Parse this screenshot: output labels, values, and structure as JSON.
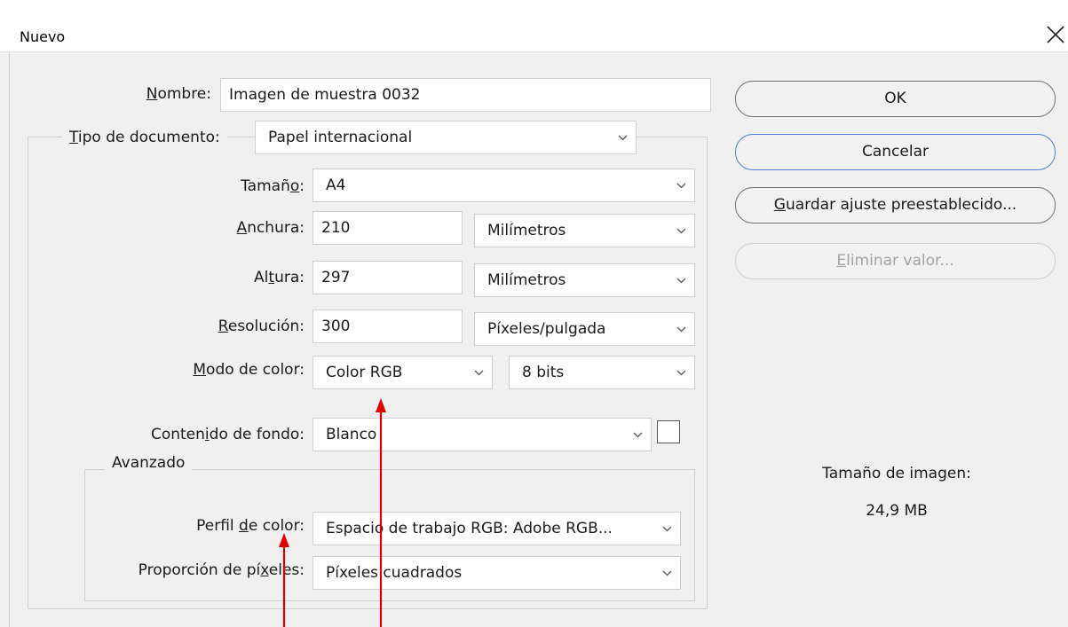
{
  "window": {
    "title": "Nuevo",
    "close_icon": "close-icon"
  },
  "form": {
    "name": {
      "label": "Nombre:",
      "mnemonic": "N",
      "value": "Imagen de muestra 0032"
    },
    "document_type": {
      "label": "Tipo de documento:",
      "mnemonic": "T",
      "value": "Papel internacional"
    },
    "size": {
      "label": "Tamaño:",
      "mnemonic": "o",
      "value": "A4"
    },
    "width": {
      "label": "Anchura:",
      "mnemonic": "A",
      "value": "210",
      "unit": "Milímetros"
    },
    "height": {
      "label": "Altura:",
      "mnemonic": "t",
      "value": "297",
      "unit": "Milímetros"
    },
    "resolution": {
      "label": "Resolución:",
      "mnemonic": "R",
      "value": "300",
      "unit": "Píxeles/pulgada"
    },
    "color_mode": {
      "label": "Modo de color:",
      "mnemonic": "M",
      "value": "Color RGB",
      "depth": "8 bits"
    },
    "background": {
      "label": "Contenido de fondo:",
      "mnemonic": "i",
      "value": "Blanco",
      "swatch_color": "#ffffff"
    },
    "advanced": {
      "legend": "Avanzado",
      "color_profile": {
        "label": "Perfil de color:",
        "mnemonic": "d",
        "value": "Espacio de trabajo RGB: Adobe RGB..."
      },
      "pixel_aspect": {
        "label": "Proporción de píxeles:",
        "mnemonic": "x",
        "value": "Píxeles cuadrados"
      }
    }
  },
  "buttons": {
    "ok": "OK",
    "cancel": "Cancelar",
    "save_preset": "Guardar ajuste preestablecido...",
    "save_preset_mnemonic": "G",
    "delete_value": "Eliminar valor...",
    "delete_value_mnemonic": "E"
  },
  "image_info": {
    "label": "Tamaño de imagen:",
    "value": "24,9 MB"
  },
  "annotations": {
    "arrow_color": "#e00000"
  }
}
